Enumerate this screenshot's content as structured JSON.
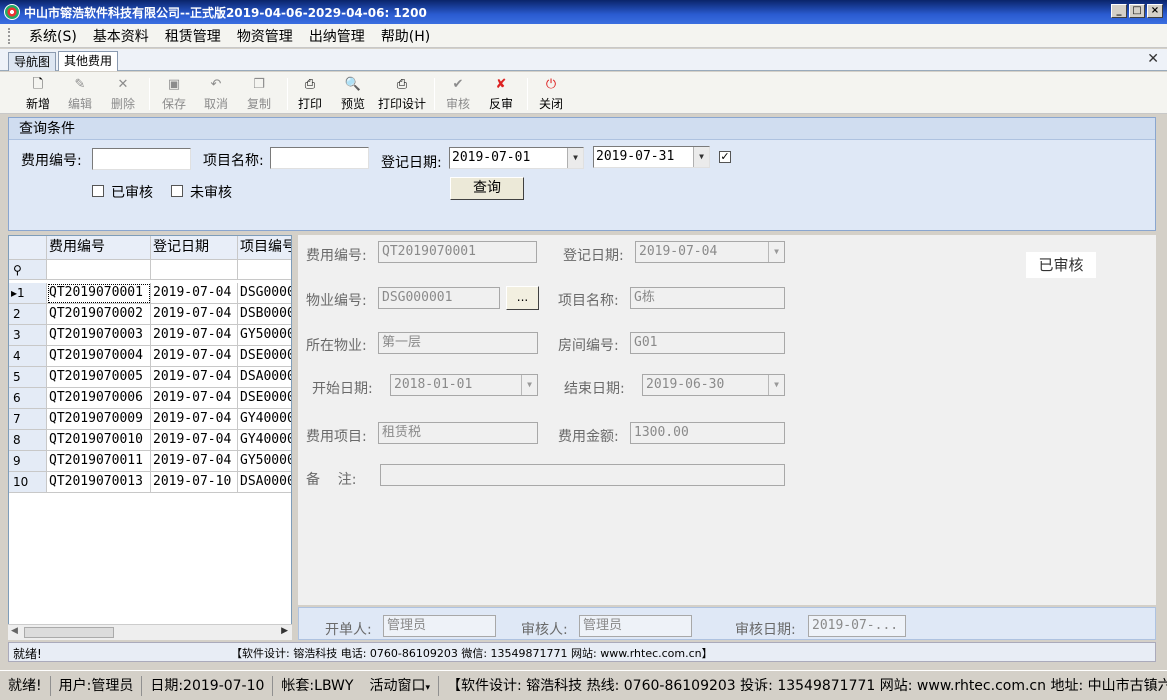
{
  "window": {
    "title": "中山市镕浩软件科技有限公司--正式版2019-04-06-2029-04-06: 1200"
  },
  "menu": [
    "系统(S)",
    "基本资料",
    "租赁管理",
    "物资管理",
    "出纳管理",
    "帮助(H)"
  ],
  "tabs": [
    "导航图",
    "其他费用"
  ],
  "toolbar": [
    {
      "label": "新增",
      "icon": "new-doc-icon",
      "enabled": true
    },
    {
      "label": "编辑",
      "icon": "edit-icon",
      "enabled": false
    },
    {
      "label": "删除",
      "icon": "delete-icon",
      "enabled": false
    },
    {
      "label": "保存",
      "icon": "save-icon",
      "enabled": false
    },
    {
      "label": "取消",
      "icon": "undo-icon",
      "enabled": false
    },
    {
      "label": "复制",
      "icon": "copy-icon",
      "enabled": false
    },
    {
      "label": "打印",
      "icon": "printer-icon",
      "enabled": true
    },
    {
      "label": "预览",
      "icon": "preview-icon",
      "enabled": true
    },
    {
      "label": "打印设计",
      "icon": "print-design-icon",
      "enabled": true
    },
    {
      "label": "审核",
      "icon": "approve-icon",
      "enabled": false
    },
    {
      "label": "反审",
      "icon": "unapprove-icon",
      "enabled": true
    },
    {
      "label": "关闭",
      "icon": "power-icon",
      "enabled": true
    }
  ],
  "query": {
    "title": "查询条件",
    "fee_no_label": "费用编号:",
    "fee_no_value": "",
    "item_name_label": "项目名称:",
    "item_name_value": "",
    "reg_date_label": "登记日期:",
    "date_from": "2019-07-01",
    "date_to": "2019-07-31",
    "date_checked": true,
    "approved_label": "已审核",
    "approved_checked": false,
    "unapproved_label": "未审核",
    "unapproved_checked": false,
    "search_button": "查询"
  },
  "grid": {
    "columns": [
      "费用编号",
      "登记日期",
      "项目编号"
    ],
    "rows": [
      {
        "n": "1",
        "no": "QT2019070001",
        "date": "2019-07-04",
        "item": "DSG0000"
      },
      {
        "n": "2",
        "no": "QT2019070002",
        "date": "2019-07-04",
        "item": "DSB0000"
      },
      {
        "n": "3",
        "no": "QT2019070003",
        "date": "2019-07-04",
        "item": "GY50000"
      },
      {
        "n": "4",
        "no": "QT2019070004",
        "date": "2019-07-04",
        "item": "DSE0000"
      },
      {
        "n": "5",
        "no": "QT2019070005",
        "date": "2019-07-04",
        "item": "DSA0000"
      },
      {
        "n": "6",
        "no": "QT2019070006",
        "date": "2019-07-04",
        "item": "DSE0000"
      },
      {
        "n": "7",
        "no": "QT2019070009",
        "date": "2019-07-04",
        "item": "GY40000"
      },
      {
        "n": "8",
        "no": "QT2019070010",
        "date": "2019-07-04",
        "item": "GY40000"
      },
      {
        "n": "9",
        "no": "QT2019070011",
        "date": "2019-07-04",
        "item": "GY50000"
      },
      {
        "n": "10",
        "no": "QT2019070013",
        "date": "2019-07-10",
        "item": "DSA0000"
      }
    ]
  },
  "detail": {
    "fee_no_label": "费用编号:",
    "fee_no": "QT2019070001",
    "reg_date_label": "登记日期:",
    "reg_date": "2019-07-04",
    "property_no_label": "物业编号:",
    "property_no": "DSG000001",
    "browse": "...",
    "item_name_label": "项目名称:",
    "item_name": "G栋",
    "location_label": "所在物业:",
    "location": "第一层",
    "room_no_label": "房间编号:",
    "room_no": "G01",
    "start_label": "开始日期:",
    "start": "2018-01-01",
    "end_label": "结束日期:",
    "end": "2019-06-30",
    "fee_item_label": "费用项目:",
    "fee_item": "租赁税",
    "amount_label": "费用金额:",
    "amount": "1300.00",
    "remark_label": "备    注:",
    "remark": "",
    "stamp": "已审核"
  },
  "footer": {
    "creator_label": "开单人:",
    "creator": "管理员",
    "approver_label": "审核人:",
    "approver": "管理员",
    "approve_date_label": "审核日期:",
    "approve_date": "2019-07-..."
  },
  "inner_status": {
    "left": "就绪!",
    "center": "【软件设计: 镕浩科技 电话: 0760-86109203 微信: 13549871771 网站: www.rhtec.com.cn】"
  },
  "status": [
    "就绪!",
    "用户:管理员",
    "日期:2019-07-10",
    "帐套:LBWY",
    "活动窗口",
    "【软件设计: 镕浩科技 热线: 0760-86109203 投诉: 13549871771 网站: www.rhtec.com.cn 地址: 中山市古镇六坊"
  ]
}
